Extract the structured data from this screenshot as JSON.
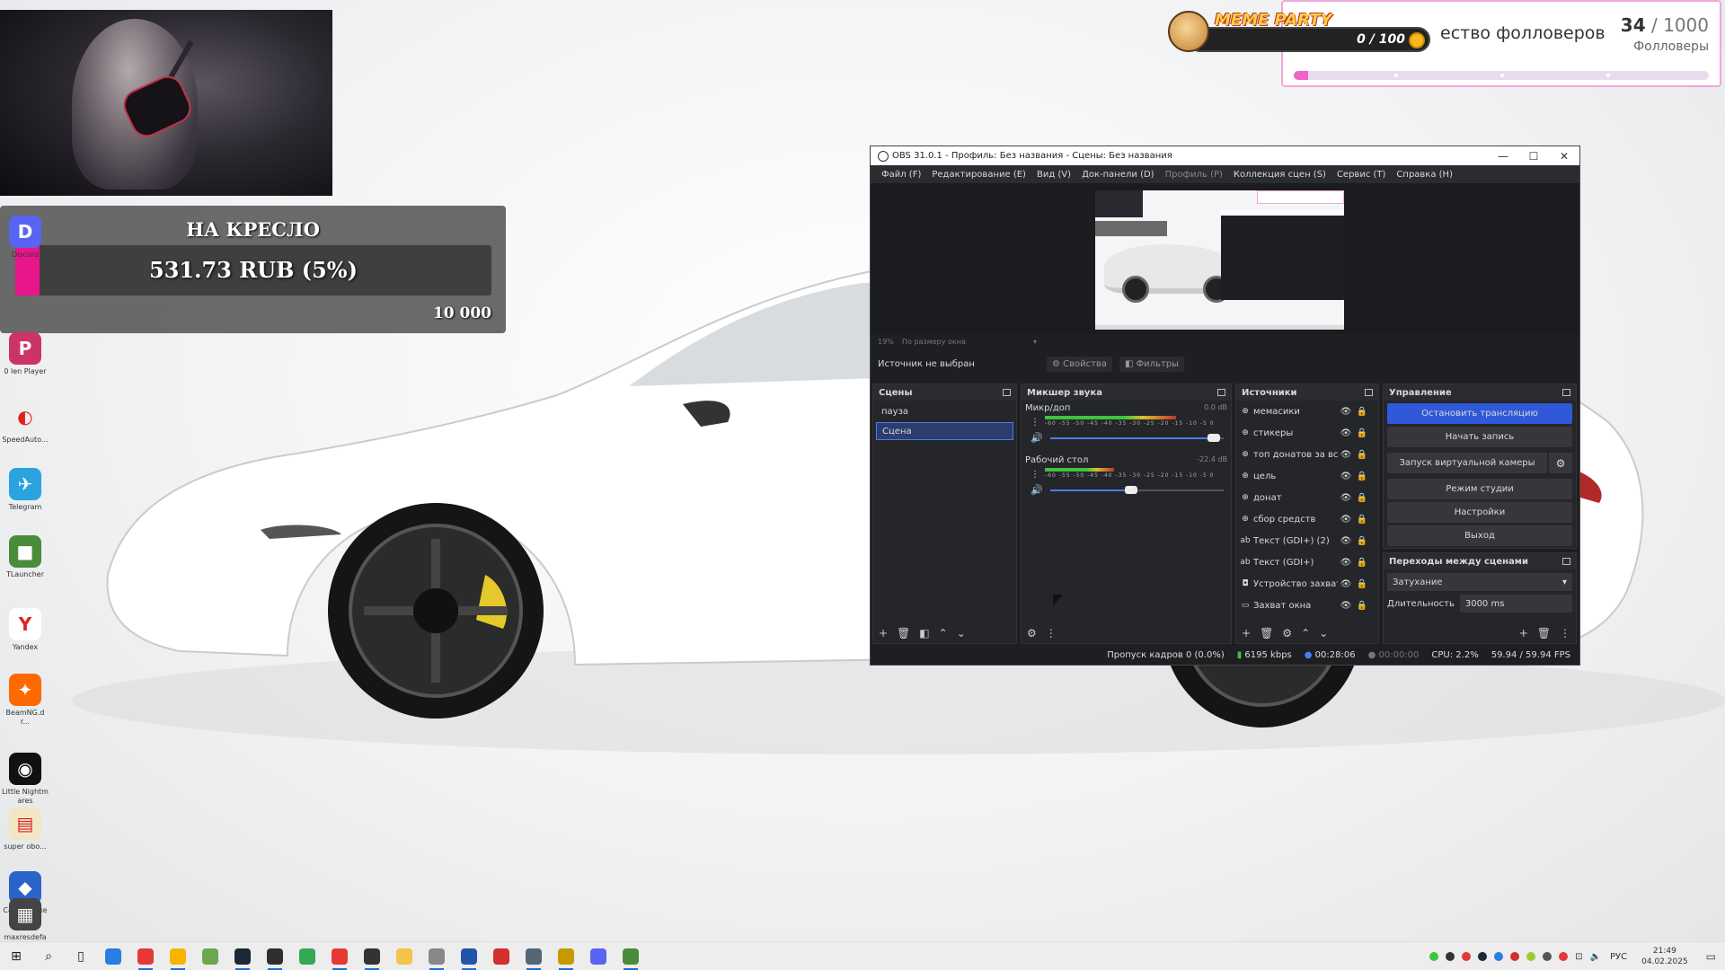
{
  "donation_goal": {
    "title": "НА КРЕСЛО",
    "amount": "531.73 RUB (5%)",
    "progress_percent": 5,
    "target": "10 000",
    "bar_color": "#e8168a"
  },
  "followers_goal": {
    "title": "ество фолловеров",
    "current": "34",
    "separator": " / ",
    "total": "1000",
    "label": "Фолловеры",
    "progress_fraction": 0.034,
    "accent": "#f062c8"
  },
  "meme_party": {
    "brand": "MEME PARTY",
    "counter": "0 / 100"
  },
  "desktop_icons": [
    {
      "name": "discord-icon",
      "label": "Discord",
      "color": "#5865f2",
      "glyph": "D"
    },
    {
      "name": "player-icon",
      "label": "0 len Player",
      "color": "#cc3366",
      "glyph": "P"
    },
    {
      "name": "speedautoclicker-icon",
      "label": "SpeedAuto...",
      "color": "#eeeeee",
      "glyph": "◐"
    },
    {
      "name": "telegram-icon",
      "label": "Telegram",
      "color": "#2aa3df",
      "glyph": "✈"
    },
    {
      "name": "tlauncher-icon",
      "label": "TLauncher",
      "color": "#4a8c3a",
      "glyph": "■"
    },
    {
      "name": "yandex-icon",
      "label": "Yandex",
      "color": "#ffffff",
      "glyph": "Y"
    },
    {
      "name": "beamng-icon",
      "label": "BeamNG.dr...",
      "color": "#ff6a00",
      "glyph": "✦"
    },
    {
      "name": "nightmare-icon",
      "label": "Little Nightmares",
      "color": "#111111",
      "glyph": "◉"
    },
    {
      "name": "file-icon",
      "label": "super obo...",
      "color": "#f2e7c4",
      "glyph": "▤"
    },
    {
      "name": "cattoolkit-icon",
      "label": "Catmiks.exe",
      "color": "#2a64c8",
      "glyph": "◆"
    },
    {
      "name": "image-icon",
      "label": "maxresdefault — копия.jpg",
      "color": "#444444",
      "glyph": "▦"
    }
  ],
  "obs": {
    "window_title": "OBS 31.0.1 - Профиль: Без названия - Сцены: Без названия",
    "window_controls": [
      "—",
      "☐",
      "✕"
    ],
    "menu": [
      "Файл (F)",
      "Редактирование (E)",
      "Вид (V)",
      "Док-панели (D)",
      "Профиль (P)",
      "Коллекция сцен (S)",
      "Сервис (T)",
      "Справка (H)"
    ],
    "zoom": "19%",
    "zoom_mode": "По размеру окна",
    "source_none": "Источник не выбран",
    "properties_btn": "Свойства",
    "filters_btn": "Фильтры",
    "scenes": {
      "title": "Сцены",
      "items": [
        {
          "label": "пауза",
          "active": false
        },
        {
          "label": "Сцена",
          "active": true
        }
      ]
    },
    "mixer": {
      "title": "Микшер звука",
      "channels": [
        {
          "name": "Микр/доп",
          "db": "0.0 dB",
          "level": 0.72,
          "volume": 0.98
        },
        {
          "name": "Рабочий стол",
          "db": "-22.4 dB",
          "level": 0.38,
          "volume": 0.5
        }
      ],
      "scale": "-60 -55 -50 -45 -40 -35 -30 -25 -20 -15 -10 -5 0"
    },
    "sources": {
      "title": "Источники",
      "items": [
        {
          "label": "мемасики",
          "icon": "⊕"
        },
        {
          "label": "стикеры",
          "icon": "⊕"
        },
        {
          "label": "топ донатов за всё",
          "icon": "⊕"
        },
        {
          "label": "цель",
          "icon": "⊕"
        },
        {
          "label": "донат",
          "icon": "⊕"
        },
        {
          "label": "сбор средств",
          "icon": "⊕"
        },
        {
          "label": "Текст (GDI+) (2)",
          "icon": "ab"
        },
        {
          "label": "Текст (GDI+)",
          "icon": "ab"
        },
        {
          "label": "Устройство захват",
          "icon": "◘"
        },
        {
          "label": "Захват окна",
          "icon": "▭"
        }
      ]
    },
    "controls": {
      "title": "Управление",
      "stop_stream": "Остановить трансляцию",
      "start_record": "Начать запись",
      "virtual_cam": "Запуск виртуальной камеры",
      "studio_mode": "Режим студии",
      "settings": "Настройки",
      "exit": "Выход"
    },
    "transitions": {
      "title": "Переходы между сценами",
      "selected": "Затухание",
      "duration_label": "Длительность",
      "duration": "3000 ms"
    },
    "status": {
      "dropped": "Пропуск кадров 0 (0.0%)",
      "bitrate": "6195 kbps",
      "stream_time": "00:28:06",
      "rec_time": "00:00:00",
      "cpu": "CPU: 2.2%",
      "fps": "59.94 / 59.94 FPS"
    }
  },
  "taskbar": {
    "apps": [
      {
        "name": "windows-start-icon",
        "color": "#1a1a1a",
        "glyph": "⊞"
      },
      {
        "name": "search-icon",
        "color": "#1a1a1a",
        "glyph": "⌕"
      },
      {
        "name": "task-view-icon",
        "color": "#1a1a1a",
        "glyph": "▯"
      },
      {
        "name": "app-blue-icon",
        "color": "#2a7de1",
        "glyph": ""
      },
      {
        "name": "yandex-browser-icon",
        "color": "#e53935",
        "glyph": ""
      },
      {
        "name": "app-yellow-icon",
        "color": "#f4b400",
        "glyph": ""
      },
      {
        "name": "app-green-icon",
        "color": "#6aa84f",
        "glyph": ""
      },
      {
        "name": "steam-icon",
        "color": "#1b2838",
        "glyph": ""
      },
      {
        "name": "obs-icon",
        "color": "#302e31",
        "glyph": ""
      },
      {
        "name": "chrome-icon",
        "color": "#34a853",
        "glyph": ""
      },
      {
        "name": "yandex-icon",
        "color": "#e53935",
        "glyph": ""
      },
      {
        "name": "terminal-icon",
        "color": "#333333",
        "glyph": ""
      },
      {
        "name": "explorer-icon",
        "color": "#f2c44b",
        "glyph": ""
      },
      {
        "name": "app-gray-icon",
        "color": "#888888",
        "glyph": ""
      },
      {
        "name": "app-stripe-icon",
        "color": "#2255aa",
        "glyph": ""
      },
      {
        "name": "app-red-icon",
        "color": "#d32f2f",
        "glyph": ""
      },
      {
        "name": "app-photo-icon",
        "color": "#556677",
        "glyph": ""
      },
      {
        "name": "lock-app-icon",
        "color": "#c49a00",
        "glyph": ""
      },
      {
        "name": "discord-icon",
        "color": "#5865f2",
        "glyph": ""
      },
      {
        "name": "minecraft-icon",
        "color": "#4a8c3a",
        "glyph": ""
      }
    ],
    "tray_lang": "РУС",
    "time": "21:49",
    "date": "04.02.2025"
  }
}
